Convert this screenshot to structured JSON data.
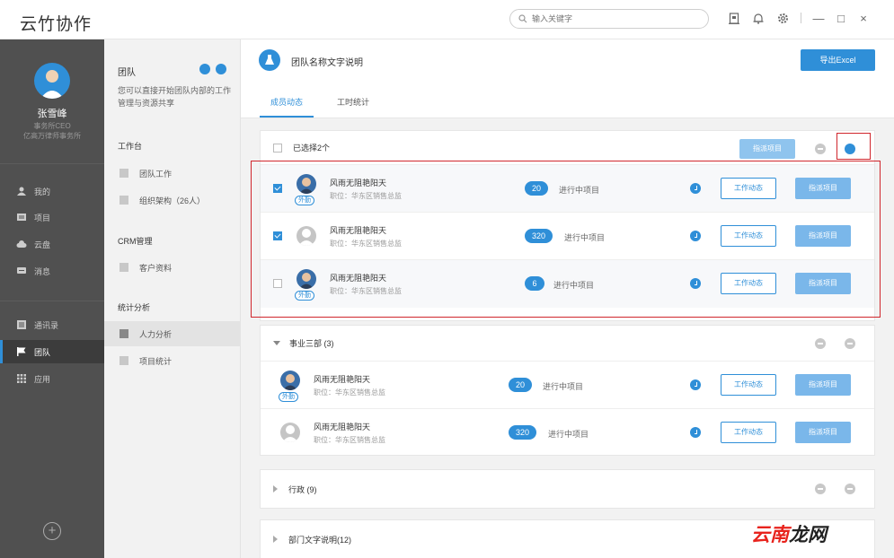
{
  "app": {
    "title": "云竹协作"
  },
  "search": {
    "placeholder": "输入关键字"
  },
  "user": {
    "name": "张雪峰",
    "title_line1": "事务所CEO",
    "title_line2": "亿高万律师事务所"
  },
  "nav": {
    "items": [
      {
        "label": "我的",
        "icon": "user-icon"
      },
      {
        "label": "项目",
        "icon": "project-icon"
      },
      {
        "label": "云盘",
        "icon": "cloud-icon"
      },
      {
        "label": "消息",
        "icon": "message-icon"
      },
      {
        "label": "通讯录",
        "icon": "contacts-icon"
      },
      {
        "label": "团队",
        "icon": "flag-icon"
      },
      {
        "label": "应用",
        "icon": "apps-icon"
      }
    ],
    "add_label": "+"
  },
  "panel": {
    "title": "团队",
    "desc": "您可以直接开始团队内部的工作管理与资源共享",
    "sections": [
      {
        "title": "工作台",
        "items": [
          "团队工作",
          "组织架构（26人）"
        ]
      },
      {
        "title": "CRM管理",
        "items": [
          "客户资料"
        ]
      },
      {
        "title": "统计分析",
        "items": [
          "人力分析",
          "项目统计"
        ]
      }
    ]
  },
  "main": {
    "team_name": "团队名称文字说明",
    "export_label": "导出Excel",
    "tabs": [
      "成员动态",
      "工时统计"
    ],
    "selected_text": "已选择2个",
    "assign_label": "指派项目",
    "dynamic_label": "工作动态",
    "project_label": "进行中项目",
    "outside_tag": "外勤",
    "selected_group": [
      {
        "name": "风雨无阻艳阳天",
        "position": "职位：华东区销售总监",
        "count": "20",
        "checked": true,
        "avatar": "photo",
        "outside": true
      },
      {
        "name": "风雨无阻艳阳天",
        "position": "职位：华东区销售总监",
        "count": "320",
        "checked": true,
        "avatar": "blank",
        "outside": false
      },
      {
        "name": "风雨无阻艳阳天",
        "position": "职位：华东区销售总监",
        "count": "6",
        "checked": false,
        "avatar": "photo",
        "outside": true
      }
    ],
    "group2": {
      "title": "事业三部 (3)",
      "rows": [
        {
          "name": "风雨无阻艳阳天",
          "position": "职位：华东区销售总监",
          "count": "20",
          "avatar": "photo",
          "outside": true
        },
        {
          "name": "风雨无阻艳阳天",
          "position": "职位：华东区销售总监",
          "count": "320",
          "avatar": "blank",
          "outside": false
        }
      ]
    },
    "group3": {
      "title": "行政 (9)"
    },
    "group4": {
      "title": "部门文字说明(12)"
    }
  },
  "watermark": {
    "part1": "云南",
    "part2": "龙网"
  },
  "colors": {
    "accent": "#2f8fd8",
    "sidebar": "#505050",
    "highlight": "#d0262c"
  }
}
